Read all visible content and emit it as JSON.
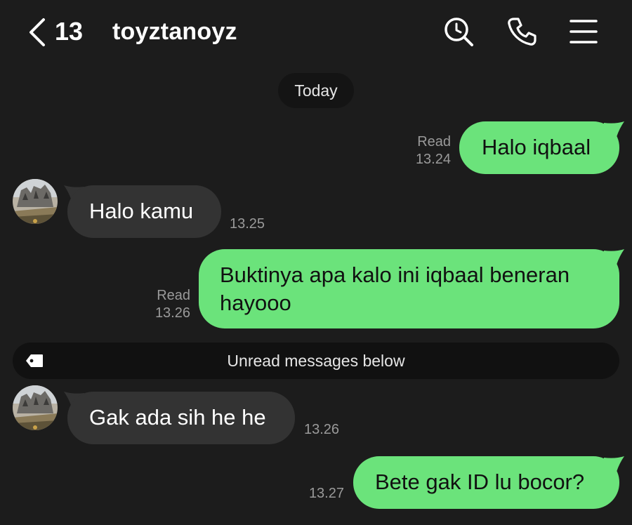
{
  "header": {
    "back_count": "13",
    "title": "toyztanoyz",
    "icons": [
      "chevron-left-icon",
      "search-icon",
      "phone-icon",
      "menu-icon"
    ]
  },
  "date_separator": "Today",
  "messages": [
    {
      "direction": "outgoing",
      "text": "Halo iqbaal",
      "status": "Read",
      "time": "13.24"
    },
    {
      "direction": "incoming",
      "text": "Halo kamu",
      "time": "13.25"
    },
    {
      "direction": "outgoing",
      "text": "Buktinya apa kalo ini iqbaal beneran hayooo",
      "status": "Read",
      "time": "13.26"
    },
    {
      "direction": "incoming",
      "text": "Gak ada sih he he",
      "time": "13.26"
    },
    {
      "direction": "outgoing",
      "text": "Bete gak ID lu bocor?",
      "time": "13.27"
    }
  ],
  "unread_divider": {
    "label": "Unread messages below",
    "icon": "tag-icon"
  },
  "colors": {
    "background": "#1c1c1c",
    "outgoing_bubble": "#6be37b",
    "incoming_bubble": "#333333",
    "meta_text": "#9a9a9a"
  }
}
